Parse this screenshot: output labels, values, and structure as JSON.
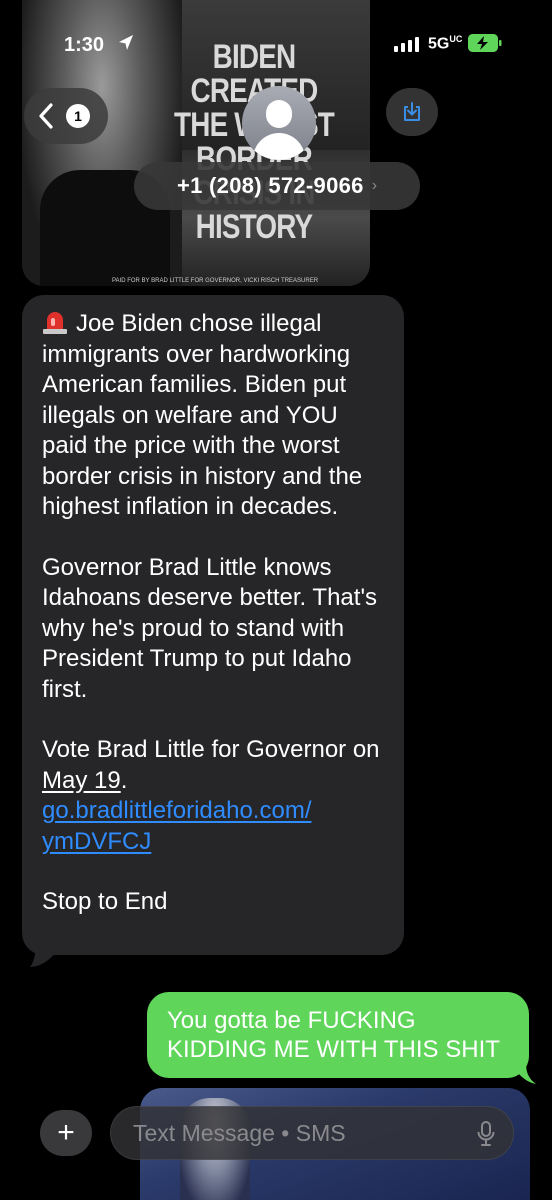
{
  "status_bar": {
    "time": "1:30",
    "network": "5G",
    "network_sup": "UC"
  },
  "header": {
    "unread_count": "1",
    "phone_number": "+1 (208) 572-9066",
    "chevron": "›"
  },
  "attachment_top": {
    "headline": "BIDEN CREATED THE WORST BORDER CRISIS IN HISTORY",
    "disclaimer": "PAID FOR BY BRAD LITTLE FOR GOVERNOR, VICKI RISCH TREASURER"
  },
  "messages": {
    "incoming": {
      "paragraph1": "Joe Biden chose illegal immigrants over hardworking American families. Biden put illegals on welfare and YOU paid the price with the worst border crisis in history and the highest inflation in decades.",
      "paragraph2": "Governor Brad Little knows Idahoans deserve better. That's why he's proud to stand with President Trump to put Idaho first.",
      "vote_prefix": "Vote Brad Little for Governor on",
      "vote_date": "May 19",
      "vote_suffix": ".",
      "link_line1": "go.bradlittleforidaho.com/",
      "link_line2": "ymDVFCJ",
      "stop": "Stop to End"
    },
    "outgoing": {
      "text": "You gotta be FUCKING KIDDING ME WITH THIS SHIT"
    }
  },
  "input_bar": {
    "placeholder": "Text Message • SMS",
    "plus": "+"
  },
  "colors": {
    "incoming_bubble": "#262628",
    "outgoing_bubble": "#5fd65a",
    "link": "#2f8cff",
    "background": "#000000"
  },
  "icons": [
    "location-arrow-icon",
    "signal-icon",
    "battery-charging-icon",
    "back-chevron-icon",
    "contact-avatar-icon",
    "save-download-icon",
    "siren-emoji-icon",
    "plus-icon",
    "microphone-icon"
  ]
}
